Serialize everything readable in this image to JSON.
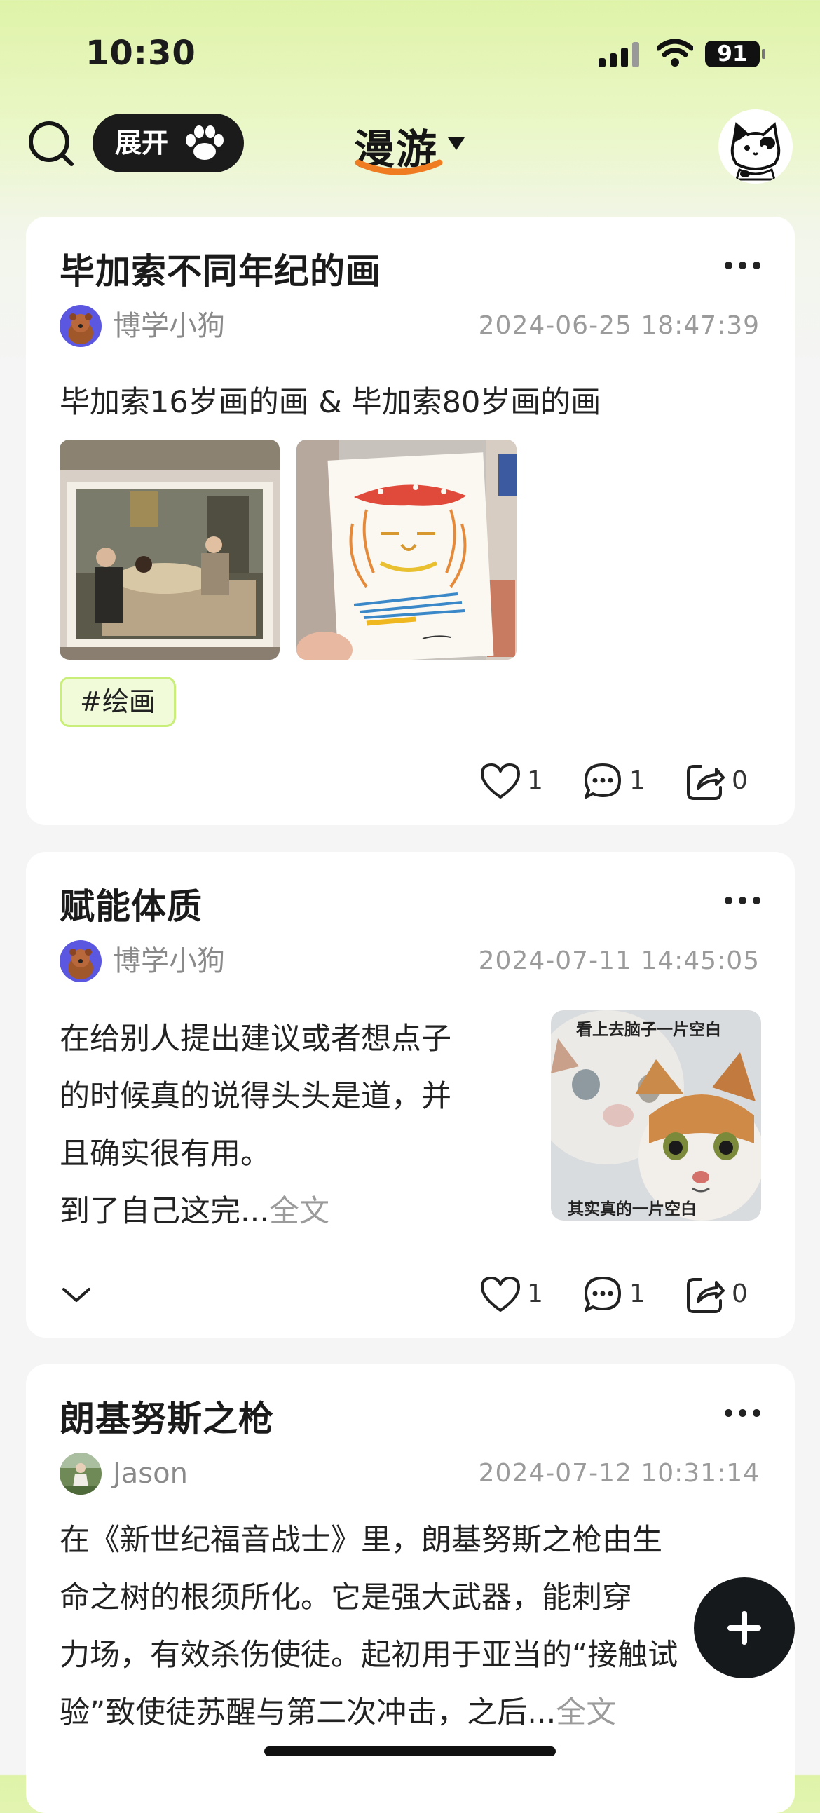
{
  "status_bar": {
    "time": "10:30",
    "battery": "91"
  },
  "header": {
    "expand_label": "展开",
    "title": "漫游"
  },
  "posts": [
    {
      "title": "毕加索不同年纪的画",
      "author": "博学小狗",
      "time": "2024-06-25 18:47:39",
      "text": "毕加索16岁画的画 & 毕加索80岁画的画",
      "tag": "#绘画",
      "likes": "1",
      "comments": "1",
      "shares": "0"
    },
    {
      "title": "赋能体质",
      "author": "博学小狗",
      "time": "2024-07-11 14:45:05",
      "lines": [
        "在给别人提出建议或者想点子",
        "的时候真的说得头头是道，并",
        "且确实很有用。",
        "到了自己这完..."
      ],
      "fulltext_label": "全文",
      "image_caption_top": "看上去脑子一片空白",
      "image_caption_bottom": "其实真的一片空白",
      "likes": "1",
      "comments": "1",
      "shares": "0"
    },
    {
      "title": "朗基努斯之枪",
      "author": "Jason",
      "time": "2024-07-12 10:31:14",
      "lines": [
        "在《新世纪福音战士》里，朗基努斯之枪由生",
        "命之树的根须所化。它是强大武器，能刺穿",
        "力场，有效杀伤使徒。起初用于亚当的“接触试",
        "验”致使徒苏醒与第二次冲击，之后..."
      ],
      "fulltext_label": "全文"
    }
  ],
  "colors": {
    "accent_green": "#c9ee79",
    "accent_orange": "#f07c22",
    "fab": "#16191c"
  },
  "icons": [
    "search-icon",
    "paw-icon",
    "dropdown-arrow-icon",
    "cat-avatar-icon",
    "more-icon",
    "heart-icon",
    "comment-icon",
    "share-icon",
    "chevron-down-icon",
    "plus-icon"
  ]
}
